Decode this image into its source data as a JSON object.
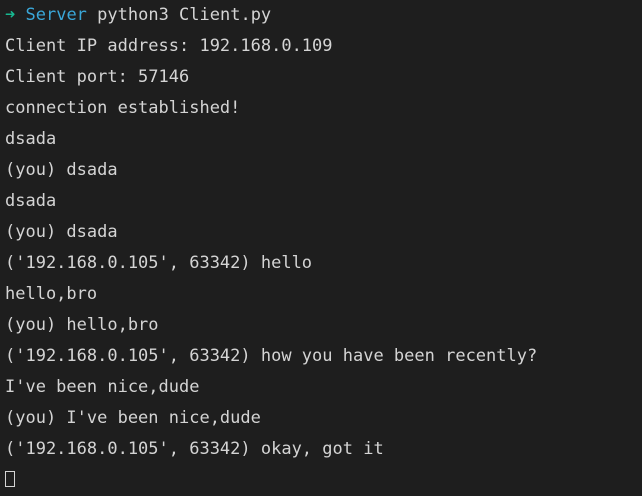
{
  "prompt": {
    "arrow": "➜",
    "directory": "Server",
    "command": "python3 Client.py"
  },
  "output_lines": [
    "Client IP address: 192.168.0.109",
    "Client port: 57146",
    "connection established!",
    "dsada",
    "(you) dsada",
    "dsada",
    "(you) dsada",
    "('192.168.0.105', 63342) hello",
    "hello,bro",
    "(you) hello,bro",
    "('192.168.0.105', 63342) how you have been recently?",
    "I've been nice,dude",
    "(you) I've been nice,dude",
    "('192.168.0.105', 63342) okay, got it"
  ],
  "colors": {
    "background": "#1e1e1e",
    "text": "#d4d4d4",
    "prompt_arrow": "#17b890",
    "prompt_dir": "#3aa7d8"
  }
}
